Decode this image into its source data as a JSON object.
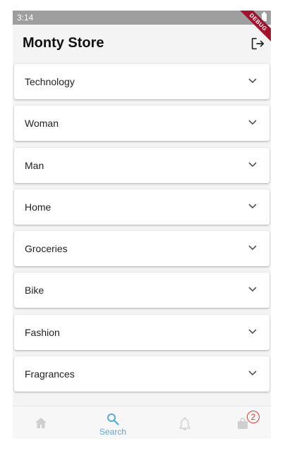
{
  "status_bar": {
    "time": "3:14"
  },
  "debug_banner": "DEBUG",
  "app_bar": {
    "title": "Monty Store"
  },
  "categories": [
    {
      "label": "Technology"
    },
    {
      "label": "Woman"
    },
    {
      "label": "Man"
    },
    {
      "label": "Home"
    },
    {
      "label": "Groceries"
    },
    {
      "label": "Bike"
    },
    {
      "label": "Fashion"
    },
    {
      "label": "Fragrances"
    }
  ],
  "bottom_nav": {
    "items": [
      {
        "icon": "home-icon",
        "label": "",
        "active": false
      },
      {
        "icon": "search-icon",
        "label": "Search",
        "active": true
      },
      {
        "icon": "bell-icon",
        "label": "",
        "active": false
      },
      {
        "icon": "shopping-bag-icon",
        "label": "",
        "active": false,
        "badge": "2"
      }
    ]
  },
  "colors": {
    "active_nav": "#5aa7dc",
    "inactive_nav": "#cfcfcf",
    "badge": "#e53935",
    "debug_banner": "#a2132b"
  }
}
